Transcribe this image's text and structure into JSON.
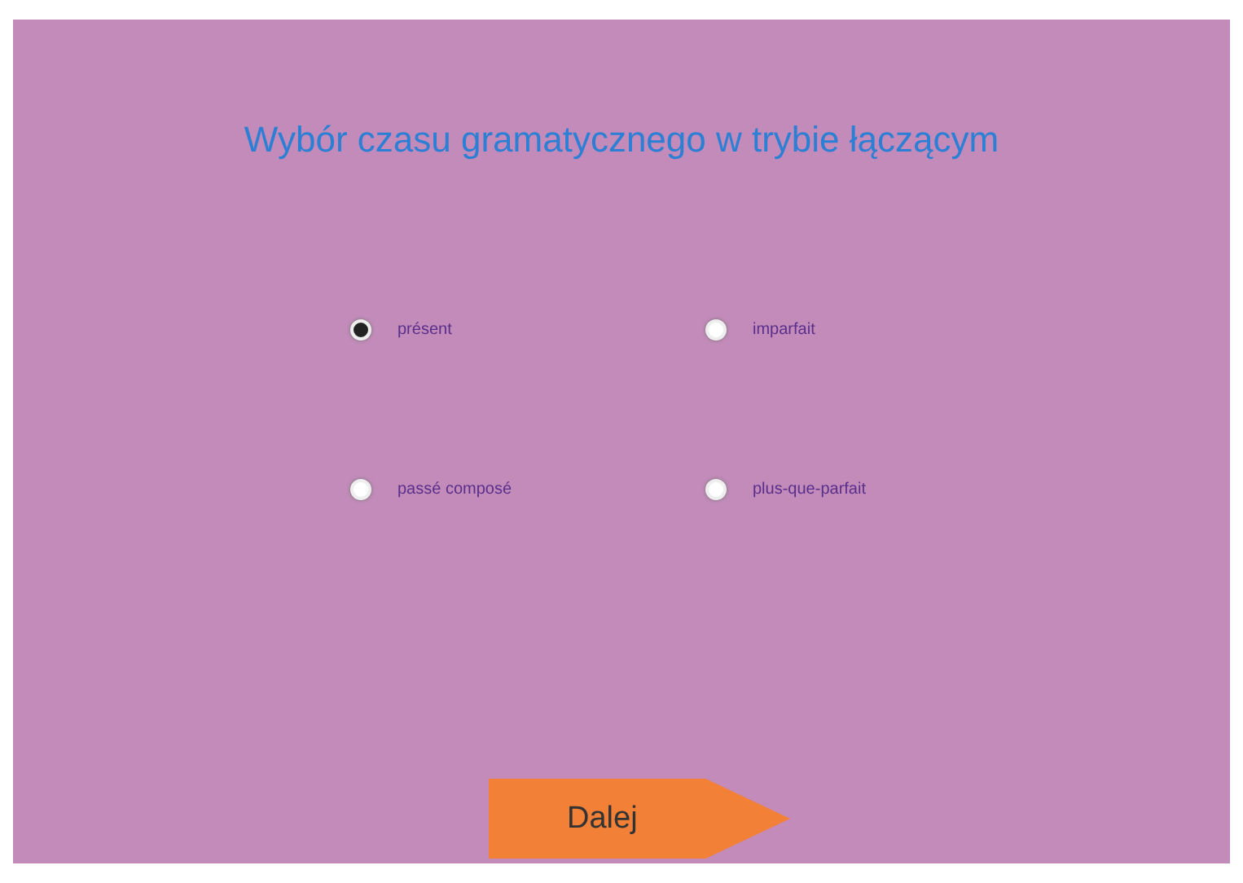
{
  "title": "Wybór czasu gramatycznego w trybie łączącym",
  "options": [
    {
      "label": "présent",
      "selected": true
    },
    {
      "label": "imparfait",
      "selected": false
    },
    {
      "label": "passé composé",
      "selected": false
    },
    {
      "label": "plus-que-parfait",
      "selected": false
    }
  ],
  "next_button": {
    "label": "Dalej"
  }
}
